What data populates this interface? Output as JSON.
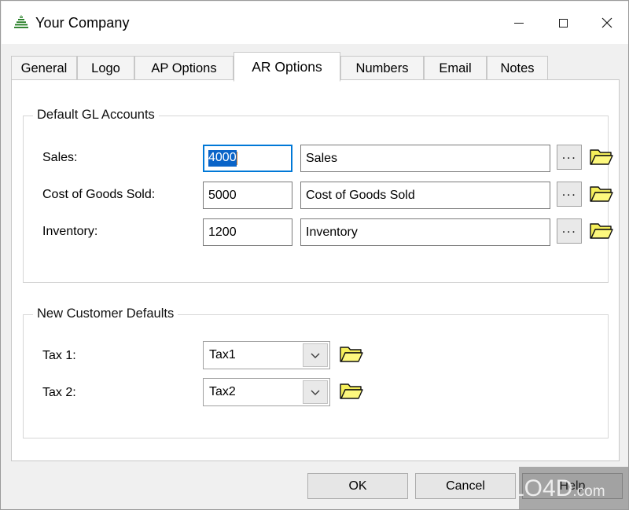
{
  "window": {
    "title": "Your Company",
    "app_icon": "layers-stack-icon",
    "controls": {
      "minimize": "minimize-icon",
      "maximize": "maximize-icon",
      "close": "close-icon"
    }
  },
  "tabs": [
    {
      "label": "General",
      "active": false
    },
    {
      "label": "Logo",
      "active": false
    },
    {
      "label": "AP Options",
      "active": false
    },
    {
      "label": "AR Options",
      "active": true
    },
    {
      "label": "Numbers",
      "active": false
    },
    {
      "label": "Email",
      "active": false
    },
    {
      "label": "Notes",
      "active": false
    }
  ],
  "groups": {
    "gl_accounts": {
      "title": "Default GL Accounts",
      "rows": [
        {
          "label": "Sales:",
          "code": "4000",
          "name": "Sales",
          "browse_label": "...",
          "folder_icon": "open-folder-icon",
          "focused": true
        },
        {
          "label": "Cost of Goods Sold:",
          "code": "5000",
          "name": "Cost of Goods Sold",
          "browse_label": "...",
          "folder_icon": "open-folder-icon",
          "focused": false
        },
        {
          "label": "Inventory:",
          "code": "1200",
          "name": "Inventory",
          "browse_label": "...",
          "folder_icon": "open-folder-icon",
          "focused": false
        }
      ]
    },
    "customer_defaults": {
      "title": "New Customer Defaults",
      "rows": [
        {
          "label": "Tax 1:",
          "value": "Tax1",
          "arrow_icon": "chevron-down-icon",
          "folder_icon": "open-folder-icon"
        },
        {
          "label": "Tax 2:",
          "value": "Tax2",
          "arrow_icon": "chevron-down-icon",
          "folder_icon": "open-folder-icon"
        }
      ]
    }
  },
  "footer": {
    "ok_label": "OK",
    "cancel_label": "Cancel",
    "help_label": "Help"
  },
  "watermark": {
    "text_main": "LO4D",
    "text_suffix": ".com",
    "logo": "circular-arrows-icon"
  },
  "colors": {
    "focus_border": "#0078d7",
    "selection": "#0a64c8",
    "caret": "#e07b20",
    "folder": "#f5ef5a",
    "window_bg": "#f0f0f0",
    "panel_bg": "#ffffff"
  }
}
